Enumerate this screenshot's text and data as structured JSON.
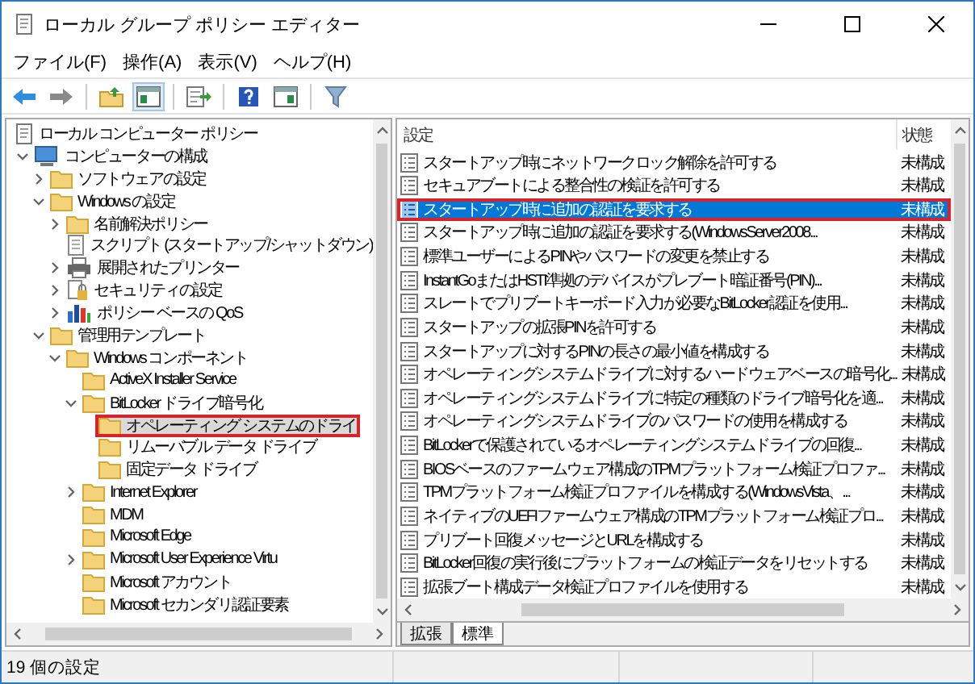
{
  "window": {
    "title": "ローカル グループ ポリシー エディター"
  },
  "menu": [
    "ファイル(F)",
    "操作(A)",
    "表示(V)",
    "ヘルプ(H)"
  ],
  "toolbar": [
    {
      "kind": "back"
    },
    {
      "kind": "forward"
    },
    {
      "kind": "sep"
    },
    {
      "kind": "up"
    },
    {
      "kind": "tree",
      "selected": true
    },
    {
      "kind": "sep"
    },
    {
      "kind": "export"
    },
    {
      "kind": "sep"
    },
    {
      "kind": "help"
    },
    {
      "kind": "view"
    },
    {
      "kind": "sep"
    },
    {
      "kind": "filter"
    }
  ],
  "tree": [
    {
      "label": "ローカル コンピューター ポリシー",
      "kind": "policy",
      "selected": false,
      "children": [
        {
          "label": "コンピューターの構成",
          "kind": "computer",
          "expanded": true,
          "selected": false,
          "children": [
            {
              "label": "ソフトウェアの設定",
              "kind": "folder",
              "expanded": false,
              "selected": false
            },
            {
              "label": "Windows の設定",
              "kind": "folder",
              "expanded": true,
              "selected": false,
              "children": [
                {
                  "label": "名前解決ポリシー",
                  "kind": "folder",
                  "expanded": false,
                  "selected": false
                },
                {
                  "label": "スクリプト (スタートアップ/シャットダウン)",
                  "kind": "script",
                  "selected": false
                },
                {
                  "label": "展開されたプリンター",
                  "kind": "printer",
                  "expanded": false,
                  "selected": false
                },
                {
                  "label": "セキュリティの設定",
                  "kind": "security",
                  "expanded": false,
                  "selected": false
                },
                {
                  "label": "ポリシー ベースの QoS",
                  "kind": "chart",
                  "expanded": false,
                  "selected": false
                }
              ]
            },
            {
              "label": "管理用テンプレート",
              "kind": "folder",
              "expanded": true,
              "selected": false,
              "children": [
                {
                  "label": "Windows コンポーネント",
                  "kind": "folder",
                  "expanded": true,
                  "selected": false,
                  "children": [
                    {
                      "label": "ActiveX Installer Service",
                      "kind": "folder",
                      "selected": false
                    },
                    {
                      "label": "BitLocker ドライブ暗号化",
                      "kind": "folder",
                      "expanded": true,
                      "selected": false,
                      "children": [
                        {
                          "label": "オペレーティング システムのドライ",
                          "kind": "folder",
                          "selected": true,
                          "annotated": true
                        },
                        {
                          "label": "リムーバブル データ ドライブ",
                          "kind": "folder",
                          "selected": false
                        },
                        {
                          "label": "固定データ ドライブ",
                          "kind": "folder",
                          "selected": false
                        }
                      ]
                    },
                    {
                      "label": "Internet Explorer",
                      "kind": "folder",
                      "expanded": false,
                      "selected": false
                    },
                    {
                      "label": "MDM",
                      "kind": "folder",
                      "selected": false
                    },
                    {
                      "label": "Microsoft Edge",
                      "kind": "folder",
                      "selected": false
                    },
                    {
                      "label": "Microsoft User Experience Virtu",
                      "kind": "folder",
                      "expanded": false,
                      "selected": false
                    },
                    {
                      "label": "Microsoft アカウント",
                      "kind": "folder",
                      "selected": false
                    },
                    {
                      "label": "Microsoft セカンダリ認証要素",
                      "kind": "folder",
                      "selected": false
                    }
                  ]
                }
              ]
            }
          ]
        }
      ]
    }
  ],
  "list": {
    "columns": [
      "設定",
      "状態"
    ],
    "rows": [
      {
        "name": "スタートアップ時にネットワーク ロック解除を許可する",
        "state": "未構成",
        "selected": false
      },
      {
        "name": "セキュア ブートによる整合性の検証を許可する",
        "state": "未構成",
        "selected": false
      },
      {
        "name": "スタートアップ時に追加の認証を要求する",
        "state": "未構成",
        "selected": true,
        "annotated": true
      },
      {
        "name": "スタートアップ時に追加の認証を要求する (Windows Server 2008 ...",
        "state": "未構成",
        "selected": false
      },
      {
        "name": "標準ユーザーによる PIN やパスワードの変更を禁止する",
        "state": "未構成",
        "selected": false
      },
      {
        "name": "InstantGo または HSTI 準拠のデバイスがプレブート暗証番号 (PIN) ...",
        "state": "未構成",
        "selected": false
      },
      {
        "name": "スレートでプリブート キーボード入力が必要な BitLocker 認証を使用...",
        "state": "未構成",
        "selected": false
      },
      {
        "name": "スタートアップの拡張 PIN を許可する",
        "state": "未構成",
        "selected": false
      },
      {
        "name": "スタートアップに対する PIN の長さの最小値を構成する",
        "state": "未構成",
        "selected": false
      },
      {
        "name": "オペレーティング システム ドライブに対するハードウェア ベースの暗号化...",
        "state": "未構成",
        "selected": false
      },
      {
        "name": "オペレーティング システム ドライブに特定の種類のドライブ暗号化を適...",
        "state": "未構成",
        "selected": false
      },
      {
        "name": "オペレーティング システム ドライブのパスワードの使用を構成する",
        "state": "未構成",
        "selected": false
      },
      {
        "name": "BitLocker で保護されているオペレーティング システム ドライブの回復...",
        "state": "未構成",
        "selected": false
      },
      {
        "name": "BIOS ベースのファームウェア構成の TPM プラットフォーム検証プロファ...",
        "state": "未構成",
        "selected": false
      },
      {
        "name": "TPM プラットフォーム検証プロファイルを構成する (Windows Vista、...",
        "state": "未構成",
        "selected": false
      },
      {
        "name": "ネイティブの UEFI ファームウェア構成の TPM プラットフォーム検証プロ...",
        "state": "未構成",
        "selected": false
      },
      {
        "name": "プリブート回復メッセージと URL を構成する",
        "state": "未構成",
        "selected": false
      },
      {
        "name": "BitLocker 回復の実行後にプラットフォームの検証データをリセットする",
        "state": "未構成",
        "selected": false
      },
      {
        "name": "拡張ブート構成データ検証プロファイルを使用する",
        "state": "未構成",
        "selected": false
      }
    ]
  },
  "view_tabs": [
    {
      "label": "拡張",
      "selected": false
    },
    {
      "label": "標準",
      "selected": true
    }
  ],
  "status_bar": {
    "text": "19 個の設定"
  }
}
